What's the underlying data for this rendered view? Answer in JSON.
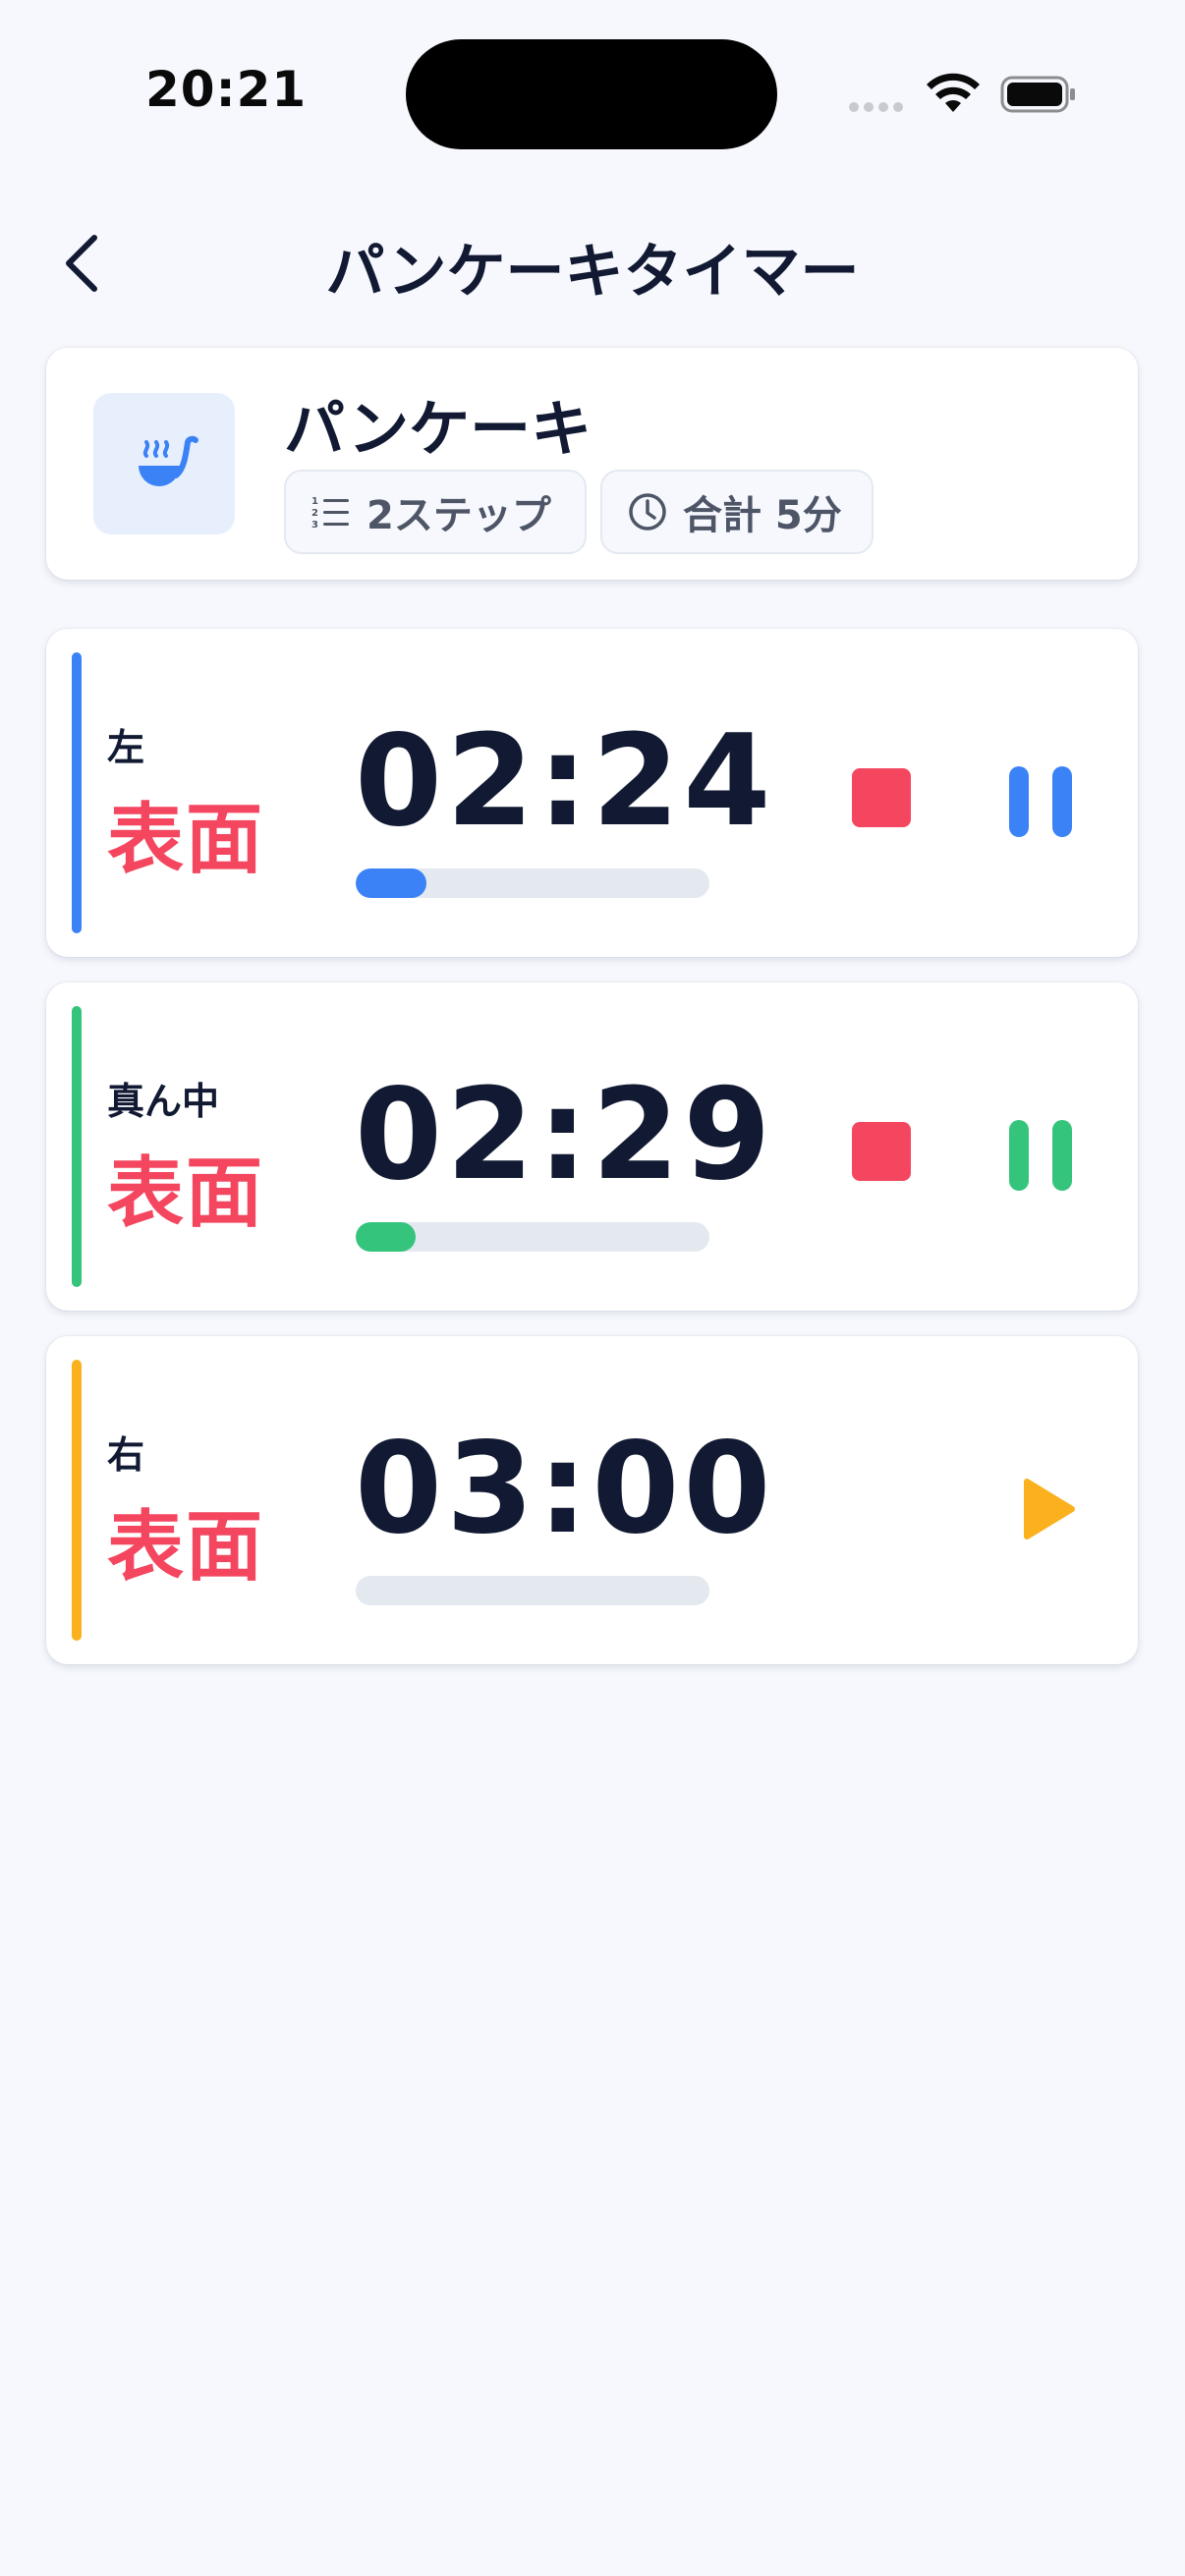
{
  "status_bar": {
    "time": "20:21"
  },
  "nav": {
    "title": "パンケーキタイマー"
  },
  "recipe": {
    "name": "パンケーキ",
    "steps_chip": "2ステップ",
    "total_chip": "合計 5分"
  },
  "timers": [
    {
      "position": "左",
      "side": "表面",
      "time": "02:24",
      "progress": 0.2,
      "state": "running",
      "accent_color": "#3b82f6"
    },
    {
      "position": "真ん中",
      "side": "表面",
      "time": "02:29",
      "progress": 0.17,
      "state": "running",
      "accent_color": "#34c47c"
    },
    {
      "position": "右",
      "side": "表面",
      "time": "03:00",
      "progress": 0.0,
      "state": "idle",
      "accent_color": "#fbb11e"
    }
  ],
  "colors": {
    "stop": "#f4465f",
    "background": "#f6f8fd",
    "text": "#121a33"
  }
}
